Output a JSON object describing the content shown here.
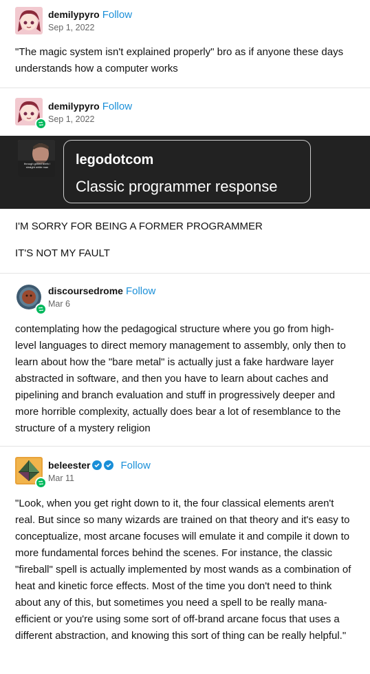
{
  "follow_label": "Follow",
  "posts": [
    {
      "username": "demilypyro",
      "date": "Sep 1, 2022",
      "body": "\"The magic system isn't explained properly\" bro as if anyone these days understands how a computer works"
    },
    {
      "username": "demilypyro",
      "date": "Sep 1, 2022",
      "embed": {
        "thumb_caption": "through gritted teeth / straight white man",
        "username": "legodotcom",
        "text": "Classic programmer response"
      },
      "lines": [
        "I'M SORRY FOR BEING A FORMER PROGRAMMER",
        "IT'S NOT MY FAULT"
      ]
    },
    {
      "username": "discoursedrome",
      "date": "Mar 6",
      "body": "contemplating how the pedagogical structure where you go from high-level languages to direct memory management to assembly, only then to learn about how the \"bare metal\" is actually just a fake hardware layer abstracted in software, and then you have to learn about caches and pipelining and branch evaluation and stuff in progressively deeper and more horrible complexity, actually does bear a lot of resemblance to the structure of a mystery religion"
    },
    {
      "username": "beleester",
      "date": "Mar 11",
      "body": "\"Look, when you get right down to it, the four classical elements aren't real.  But since so many wizards are trained on that theory and it's easy to conceptualize, most arcane focuses will emulate it and compile it down to more fundamental forces behind the scenes.  For instance, the classic \"fireball\" spell is actually implemented by most wands as a combination of heat and kinetic force effects.  Most of the time you don't need to think about any of this, but sometimes you need a spell to be really mana-efficient or you're using some sort of off-brand arcane focus that uses a different abstraction, and knowing this sort of thing can be really helpful.\""
    }
  ],
  "colors": {
    "follow": "#1a8fd8",
    "reblog_badge": "#00b85c",
    "embed_bg": "#222222"
  }
}
